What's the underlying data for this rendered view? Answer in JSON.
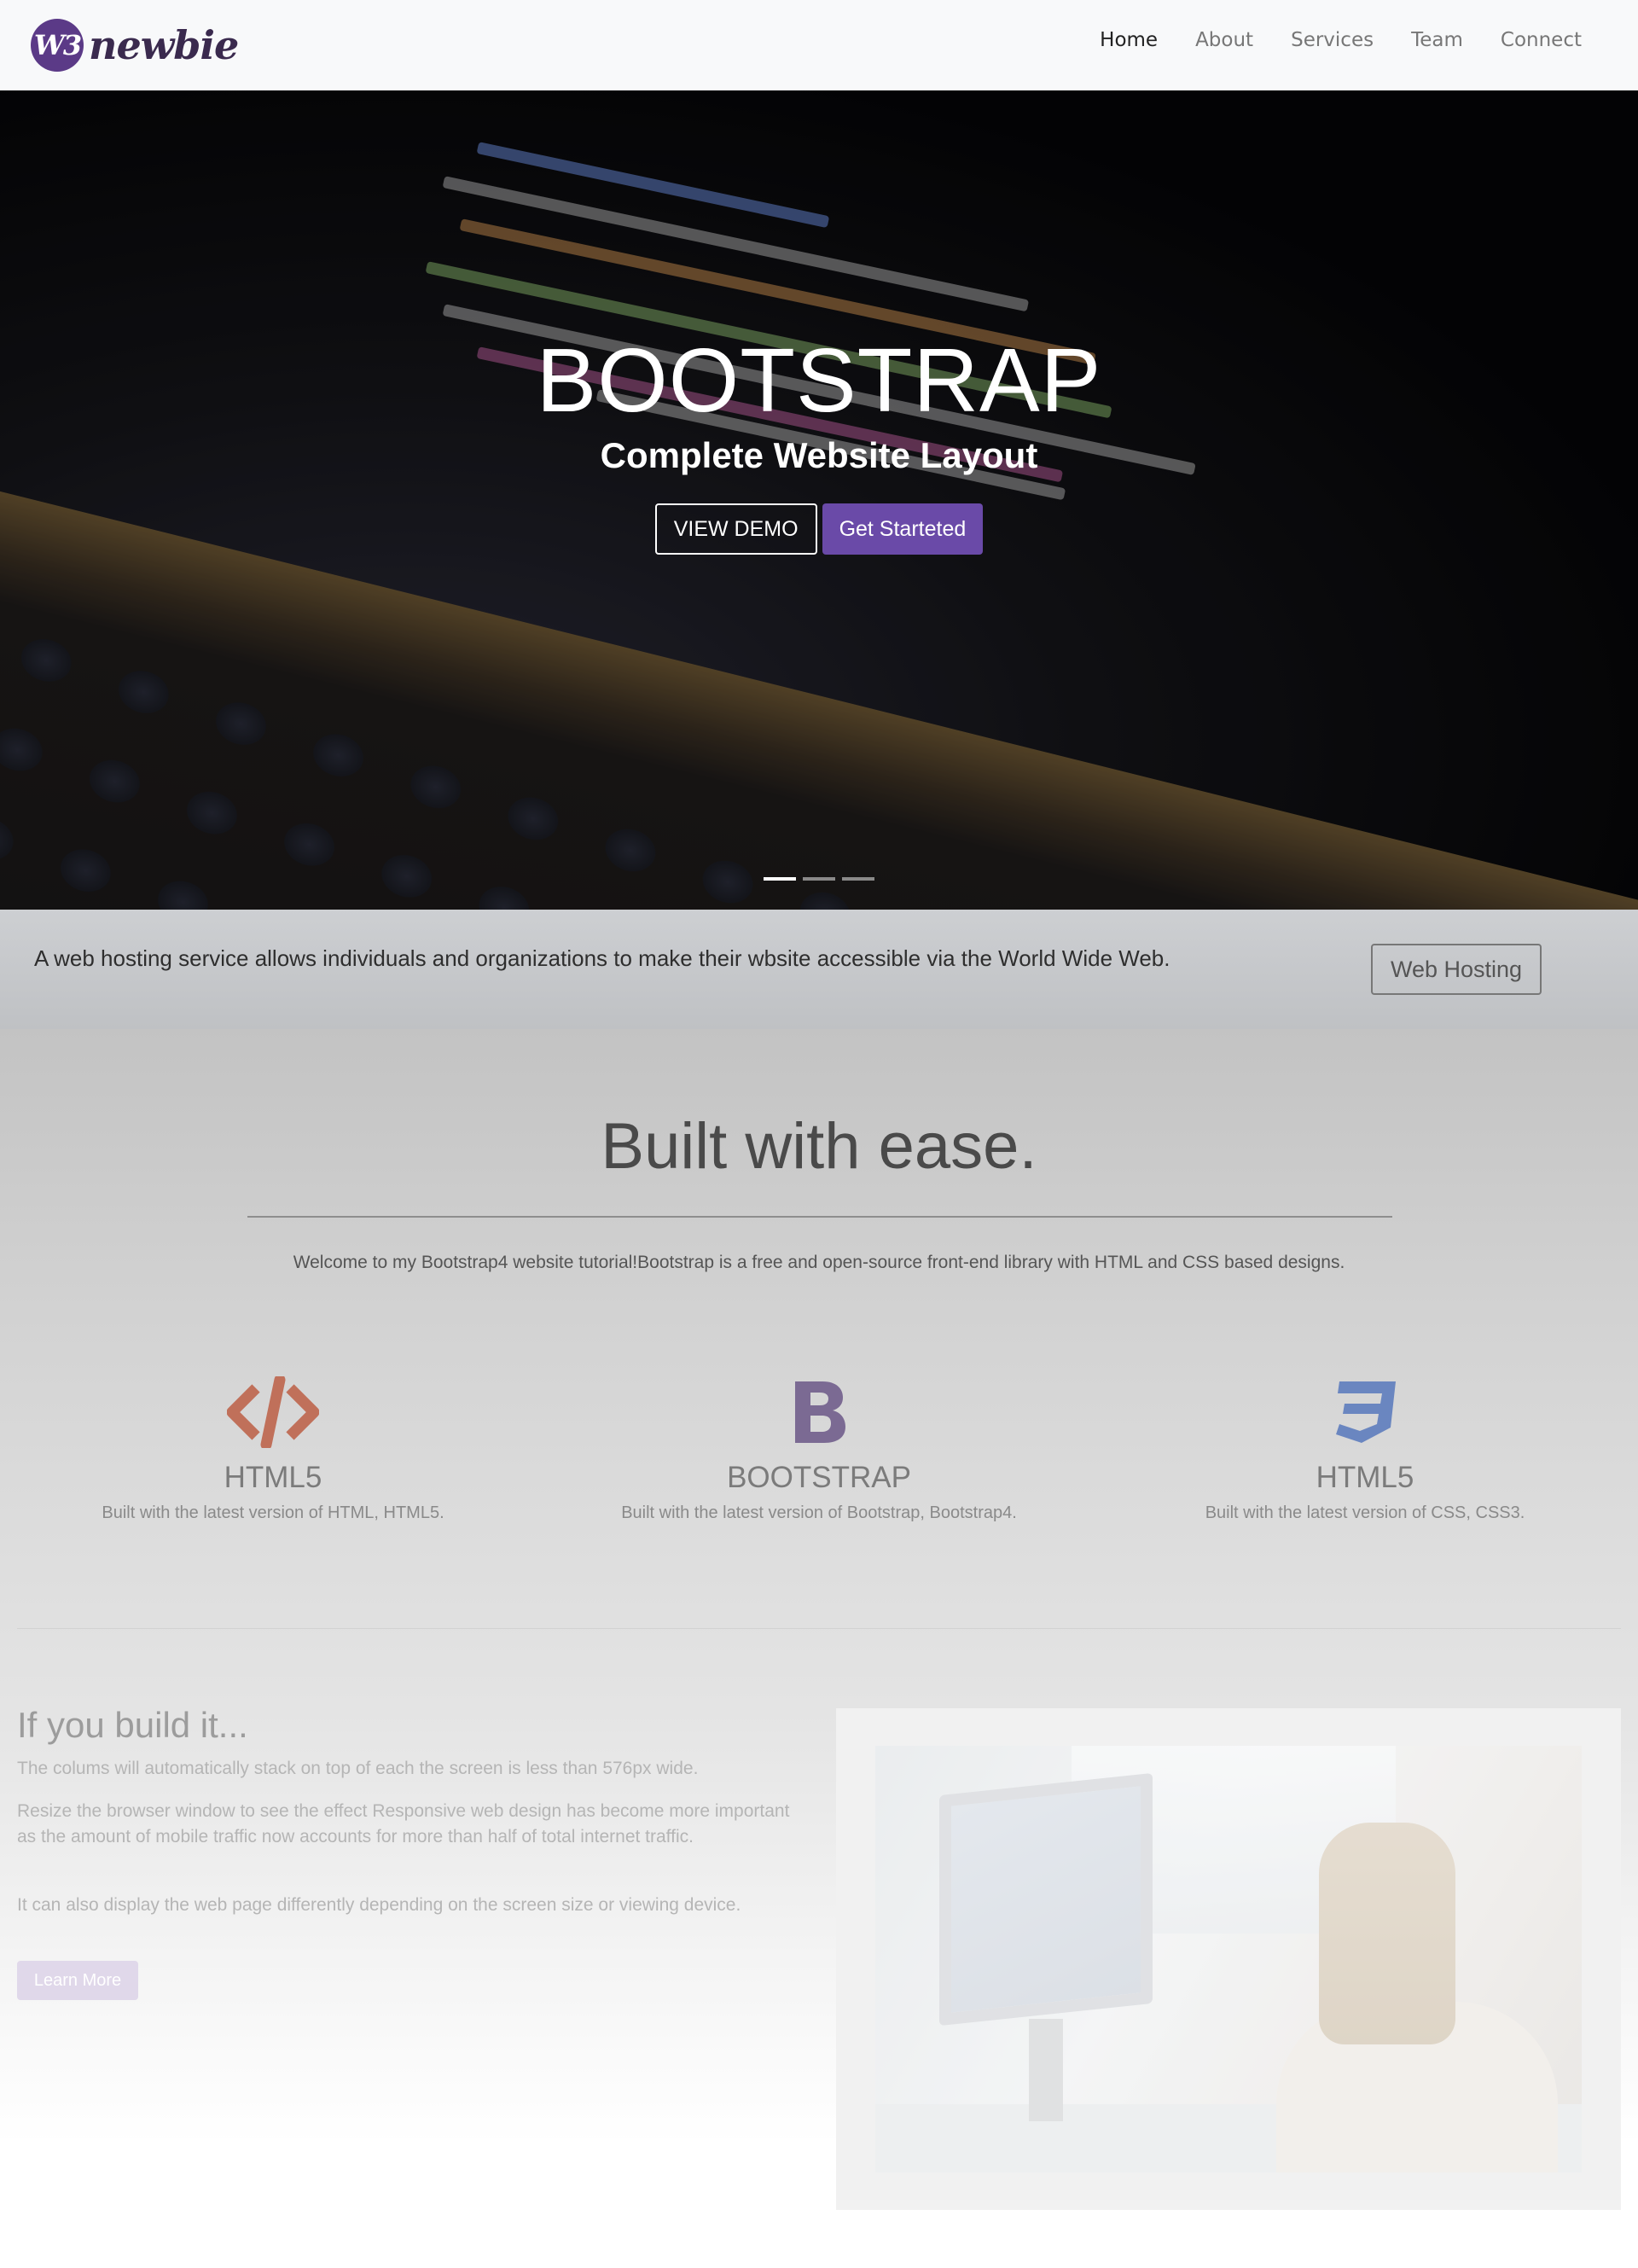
{
  "navbar": {
    "brand_badge": "W3",
    "brand_text": "newbie",
    "links": [
      {
        "label": "Home",
        "active": true
      },
      {
        "label": "About",
        "active": false
      },
      {
        "label": "Services",
        "active": false
      },
      {
        "label": "Team",
        "active": false
      },
      {
        "label": "Connect",
        "active": false
      }
    ]
  },
  "hero": {
    "title": "BOOTSTRAP",
    "subtitle": "Complete Website Layout",
    "demo_button": "VIEW DEMO",
    "start_button": "Get Starteted",
    "slides": 3,
    "active_slide": 1
  },
  "banner": {
    "text": "A web hosting service allows individuals and organizations to make their wbsite accessible via the World Wide Web.",
    "button": "Web Hosting"
  },
  "welcome": {
    "title": "Built with ease.",
    "lead": "Welcome to my Bootstrap4 website tutorial!Bootstrap is a free and open-source front-end library with HTML and CSS based designs."
  },
  "features": [
    {
      "icon": "code-icon",
      "title": "HTML5",
      "text": "Built with the latest version of HTML, HTML5.",
      "color": "#c0705a"
    },
    {
      "icon": "bootstrap-icon",
      "title": "BOOTSTRAP",
      "text": "Built with the latest version of Bootstrap, Bootstrap4.",
      "color": "#7b6a93"
    },
    {
      "icon": "css3-icon",
      "title": "HTML5",
      "text": "Built with the latest version of CSS, CSS3.",
      "color": "#6a86c0"
    }
  ],
  "build": {
    "title": "If you build it...",
    "p1": "The colums will automatically stack on top of each the screen is less than 576px wide.",
    "p2": "Resize the browser window to see the effect Responsive web design has become more important as the amount of mobile traffic now accounts for more than half of total internet traffic.",
    "p3": "It can also display the web page differently depending on the screen size or viewing device.",
    "button": "Learn More"
  },
  "colors": {
    "accent": "#6a4aa8",
    "navbar_bg": "#f8f9fa"
  }
}
